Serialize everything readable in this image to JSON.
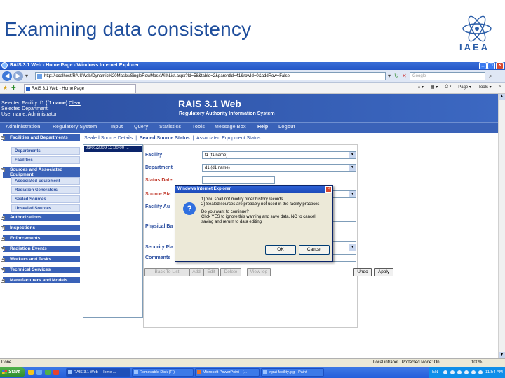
{
  "slide": {
    "title": "Examining data consistency",
    "logo_text": "IAEA"
  },
  "browser": {
    "window_title": "RAIS 3.1 Web - Home Page - Windows Internet Explorer",
    "url": "http://localhost/RAISWeb/Dynamic%20Masks/SingleRowMaskWithList.aspx?Id=58&tabId=2&parentId=41&rowId=0&addRow=False",
    "search_placeholder": "Google",
    "tab_title": "RAIS 3.1 Web - Home Page",
    "toolbar": {
      "page_label": "Page",
      "tools_label": "Tools"
    },
    "status_left": "Done",
    "status_zone": "Local intranet | Protected Mode: On",
    "zoom": "100%"
  },
  "app": {
    "selected_facility_label": "Selected Facility:",
    "selected_facility_value": "f1 (f1 name)",
    "clear_link": "Clear",
    "selected_department_label": "Selected Department:",
    "user_name_label": "User name:",
    "user_name_value": "Administrator",
    "title": "RAIS 3.1 Web",
    "subtitle": "Regulatory Authority Information System",
    "menu": [
      "Administration",
      "Regulatory System",
      "Input",
      "Query",
      "Statistics",
      "Tools",
      "Message Box",
      "Help",
      "Logout"
    ],
    "active_menu": "Help",
    "sidebar": {
      "facilities_group": "Facilities and Departments",
      "departments": "Departments",
      "facilities": "Facilities",
      "sources_group": "Sources and Associated Equipment",
      "associated_equipment": "Associated Equipment",
      "radiation_generators": "Radiation Generators",
      "sealed_sources": "Sealed Sources",
      "unsealed_sources": "Unsealed Sources",
      "authorizations": "Authorizations",
      "inspections": "Inspections",
      "enforcements": "Enforcements",
      "radiation_events": "Radiation Events",
      "workers_and_tasks": "Workers and Tasks",
      "technical_services": "Technical Services",
      "manufacturers_and_models": "Manufacturers and Models"
    },
    "tabs": [
      "Sealed Source Details",
      "Sealed Source Status",
      "Associated Equipment Status"
    ],
    "tab_sep": "|",
    "active_tab": "Sealed Source Status",
    "list_item": "01/01/2009 12:00:00 ...",
    "form": {
      "facility_label": "Facility",
      "facility_value": "f1 (f1 name)",
      "department_label": "Department",
      "department_value": "d1 (d1 name)",
      "status_date_label": "Status Date",
      "source_status_label": "Source Sta",
      "facility_auth_label": "Facility Au",
      "physical_label": "Physical Ba",
      "security_label": "Security Pla",
      "comments_label": "Comments"
    },
    "buttons": {
      "back": "Back To List",
      "add": "Add",
      "edit": "Edit",
      "delete": "Delete",
      "view_log": "View log",
      "undo": "Undo",
      "apply": "Apply"
    }
  },
  "dialog": {
    "title": "Windows Internet Explorer",
    "line1": "1) You shall not modify older history records",
    "line2": "2) Sealed sources are probably not used in the facility practices",
    "line3": "Do you want to continue?",
    "line4": "Click YES to ignore this warning and save data, NO to cancel",
    "line5": "saving and rerurn to data editing",
    "ok": "OK",
    "cancel": "Cancel"
  },
  "taskbar": {
    "start": "Start",
    "items": [
      "RAIS 3.1 Web - Home ...",
      "Removable Disk (F:)",
      "Microsoft PowerPoint - [...",
      "input facility.jpg - Paint"
    ],
    "lang": "EN",
    "clock": "11:54 AM"
  }
}
